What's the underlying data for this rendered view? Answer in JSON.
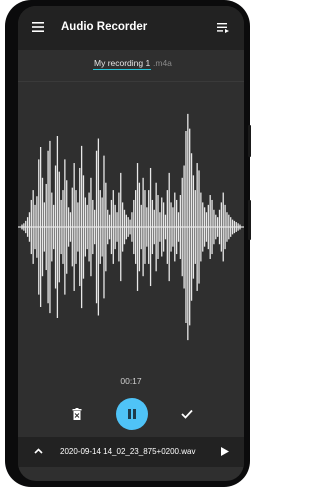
{
  "app": {
    "title": "Audio Recorder"
  },
  "recording": {
    "filename": "My recording 1",
    "extension": ".m4a",
    "elapsed": "00:17"
  },
  "bottom_bar": {
    "last_file": "2020-09-14 14_02_23_875+0200.wav"
  },
  "icons": {
    "menu": "menu-icon",
    "list": "playlist-icon",
    "delete": "delete-icon",
    "pause": "pause-icon",
    "confirm": "check-icon",
    "expand": "chevron-up-icon",
    "play": "play-icon"
  },
  "colors": {
    "accent": "#4fc3f7",
    "underline": "#26c6da",
    "background": "#2f2f2f",
    "bars": "#222222"
  },
  "waveform": {
    "amplitudes": [
      0.02,
      0.03,
      0.05,
      0.08,
      0.12,
      0.22,
      0.3,
      0.18,
      0.25,
      0.55,
      0.65,
      0.4,
      0.2,
      0.35,
      0.62,
      0.7,
      0.28,
      0.18,
      0.5,
      0.74,
      0.45,
      0.22,
      0.3,
      0.55,
      0.38,
      0.16,
      0.12,
      0.32,
      0.52,
      0.3,
      0.2,
      0.48,
      0.66,
      0.42,
      0.24,
      0.18,
      0.28,
      0.4,
      0.22,
      0.14,
      0.62,
      0.72,
      0.3,
      0.24,
      0.58,
      0.36,
      0.14,
      0.1,
      0.22,
      0.3,
      0.18,
      0.12,
      0.28,
      0.44,
      0.2,
      0.14,
      0.1,
      0.08,
      0.06,
      0.12,
      0.22,
      0.3,
      0.52,
      0.36,
      0.18,
      0.4,
      0.3,
      0.16,
      0.3,
      0.48,
      0.22,
      0.14,
      0.36,
      0.26,
      0.12,
      0.24,
      0.2,
      0.1,
      0.3,
      0.44,
      0.2,
      0.16,
      0.28,
      0.22,
      0.12,
      0.26,
      0.4,
      0.5,
      0.78,
      0.92,
      0.8,
      0.6,
      0.42,
      0.3,
      0.52,
      0.46,
      0.28,
      0.2,
      0.16,
      0.12,
      0.18,
      0.26,
      0.22,
      0.14,
      0.1,
      0.08,
      0.14,
      0.2,
      0.28,
      0.18,
      0.12,
      0.1,
      0.08,
      0.06,
      0.05,
      0.04,
      0.03,
      0.02
    ]
  }
}
